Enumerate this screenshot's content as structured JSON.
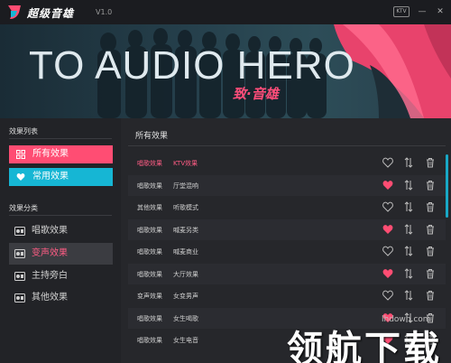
{
  "titlebar": {
    "app_name": "超级音雄",
    "version": "V1.0",
    "mode_label": "KTV",
    "minimize": "—",
    "close": "✕"
  },
  "banner": {
    "title": "TO AUDIO HERO",
    "subtitle": "致·音雄"
  },
  "sidebar": {
    "list_header": "效果列表",
    "all_effects": "所有效果",
    "common_effects": "常用效果",
    "category_header": "效果分类",
    "categories": [
      {
        "label": "唱歌效果",
        "icon": "mic-icon"
      },
      {
        "label": "变声效果",
        "icon": "mic-icon"
      },
      {
        "label": "主持旁白",
        "icon": "mic-icon"
      },
      {
        "label": "其他效果",
        "icon": "mic-icon"
      }
    ]
  },
  "content": {
    "title": "所有效果",
    "rows": [
      {
        "type": "唱歌效果",
        "name": "KTV效果",
        "fav": false
      },
      {
        "type": "唱歌效果",
        "name": "厅堂混响",
        "fav": true
      },
      {
        "type": "其他效果",
        "name": "听歌模式",
        "fav": false
      },
      {
        "type": "唱歌效果",
        "name": "喊麦另类",
        "fav": true
      },
      {
        "type": "唱歌效果",
        "name": "喊麦商业",
        "fav": false
      },
      {
        "type": "唱歌效果",
        "name": "大厅效果",
        "fav": true
      },
      {
        "type": "变声效果",
        "name": "女变男声",
        "fav": false
      },
      {
        "type": "唱歌效果",
        "name": "女生喝歌",
        "fav": true
      },
      {
        "type": "唱歌效果",
        "name": "女生电音",
        "fav": true
      }
    ]
  },
  "watermark": {
    "url": "lhdown.com",
    "text": "领航下载"
  },
  "colors": {
    "accent_pink": "#ff4d73",
    "accent_cyan": "#16b6d4"
  }
}
